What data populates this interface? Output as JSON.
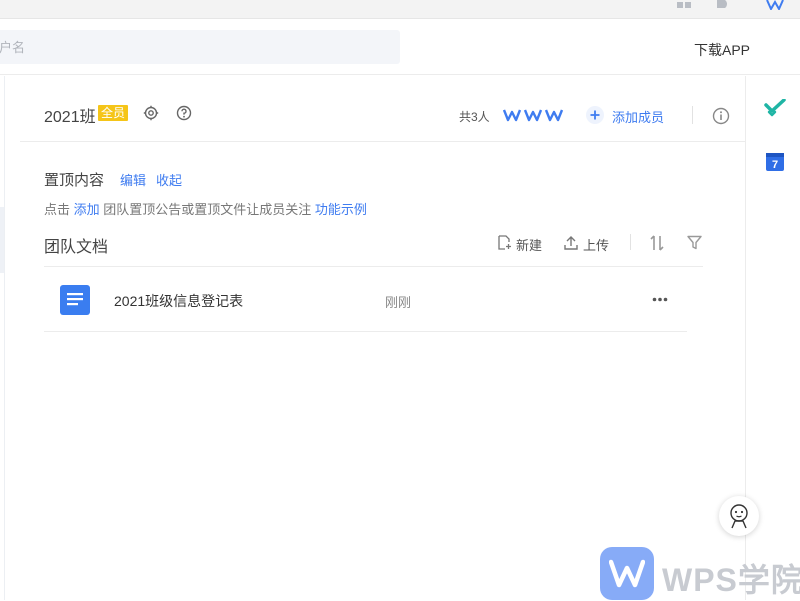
{
  "header": {
    "search_placeholder": "用户名",
    "download_label": "下载APP"
  },
  "team": {
    "title": "2021班",
    "badge": "全员",
    "member_count": "共3人",
    "add_member_label": "添加成员"
  },
  "pinned": {
    "title": "置顶内容",
    "edit_label": "编辑",
    "collapse_label": "收起",
    "desc_prefix": "点击",
    "desc_add": "添加",
    "desc_middle": "团队置顶公告或置顶文件让成员关注",
    "desc_example": "功能示例"
  },
  "docs": {
    "title": "团队文档",
    "new_label": "新建",
    "upload_label": "上传",
    "items": [
      {
        "name": "2021班级信息登记表",
        "time": "刚刚"
      }
    ]
  },
  "right_sidebar": {
    "calendar_day": "7"
  },
  "watermark": {
    "text": "WPS学院"
  },
  "colors": {
    "accent": "#3f7cf0",
    "badge": "#f5c518",
    "doc_icon": "#3a7df0",
    "check_icon": "#1fb5a5"
  }
}
